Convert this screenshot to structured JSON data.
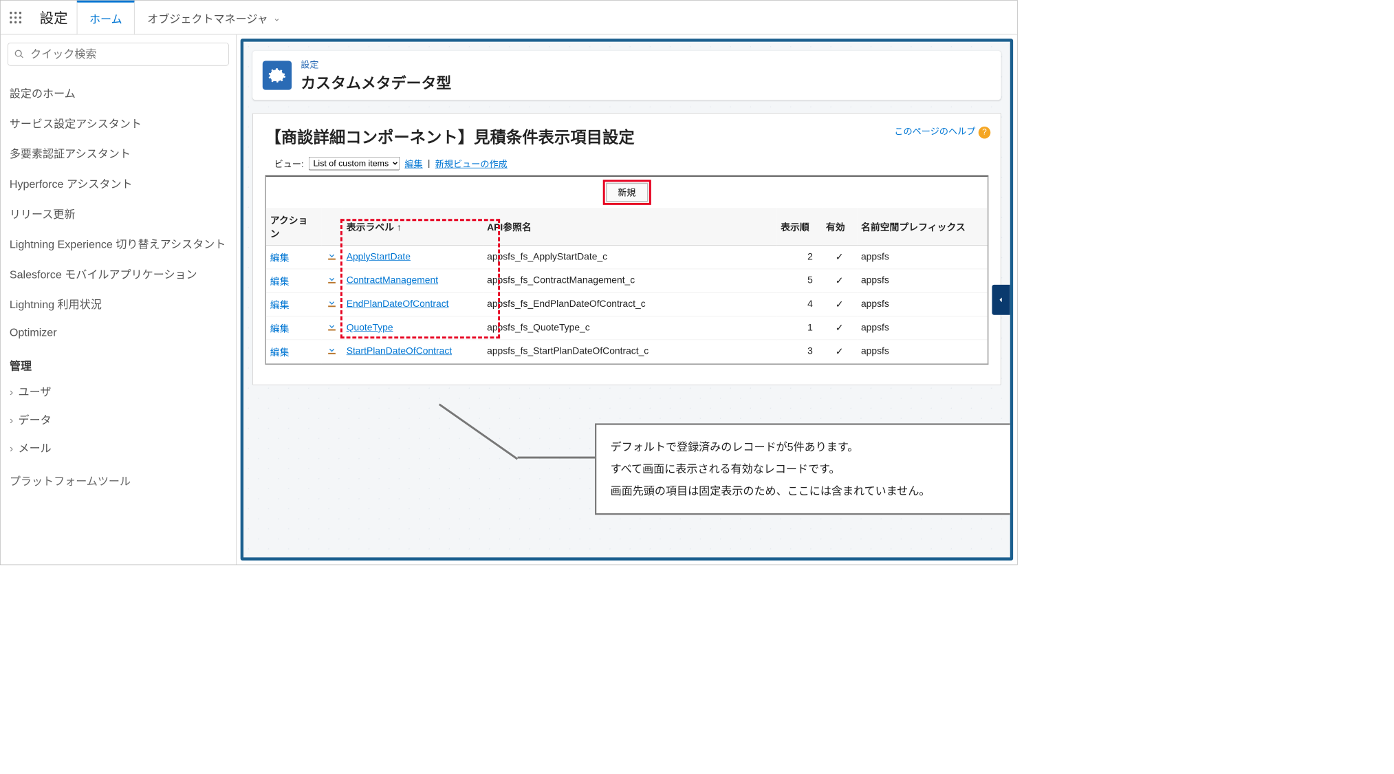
{
  "topbar": {
    "app_title": "設定",
    "tabs": [
      {
        "label": "ホーム",
        "active": true
      },
      {
        "label": "オブジェクトマネージャ",
        "active": false,
        "dropdown": true
      }
    ]
  },
  "sidebar": {
    "search_placeholder": "クイック検索",
    "items": [
      "設定のホーム",
      "サービス設定アシスタント",
      "多要素認証アシスタント",
      "Hyperforce アシスタント",
      "リリース更新",
      "Lightning Experience 切り替えアシスタント",
      "Salesforce モバイルアプリケーション",
      "Lightning 利用状況",
      "Optimizer"
    ],
    "section_label": "管理",
    "sub_items": [
      "ユーザ",
      "データ",
      "メール"
    ],
    "footer_label": "プラットフォームツール"
  },
  "hero": {
    "sup": "設定",
    "title": "カスタムメタデータ型"
  },
  "panel": {
    "heading": "【商談詳細コンポーネント】見積条件表示項目設定",
    "help_link": "このページのヘルプ",
    "view_label": "ビュー:",
    "view_option": "List of custom items",
    "edit_link": "編集",
    "new_view_link": "新規ビューの作成",
    "new_button": "新規",
    "columns": {
      "action": "アクション",
      "label": "表示ラベル ↑",
      "api": "API参照名",
      "order": "表示順",
      "active": "有効",
      "ns": "名前空間プレフィックス"
    },
    "rows": [
      {
        "action": "編集",
        "label": "ApplyStartDate",
        "api": "appsfs_fs_ApplyStartDate_c",
        "order": "2",
        "active": "✓",
        "ns": "appsfs"
      },
      {
        "action": "編集",
        "label": "ContractManagement",
        "api": "appsfs_fs_ContractManagement_c",
        "order": "5",
        "active": "✓",
        "ns": "appsfs"
      },
      {
        "action": "編集",
        "label": "EndPlanDateOfContract",
        "api": "appsfs_fs_EndPlanDateOfContract_c",
        "order": "4",
        "active": "✓",
        "ns": "appsfs"
      },
      {
        "action": "編集",
        "label": "QuoteType",
        "api": "appsfs_fs_QuoteType_c",
        "order": "1",
        "active": "✓",
        "ns": "appsfs"
      },
      {
        "action": "編集",
        "label": "StartPlanDateOfContract",
        "api": "appsfs_fs_StartPlanDateOfContract_c",
        "order": "3",
        "active": "✓",
        "ns": "appsfs"
      }
    ]
  },
  "callout": {
    "line1": "デフォルトで登録済みのレコードが5件あります。",
    "line2": "すべて画面に表示される有効なレコードです。",
    "line3": "画面先頭の項目は固定表示のため、ここには含まれていません。"
  }
}
